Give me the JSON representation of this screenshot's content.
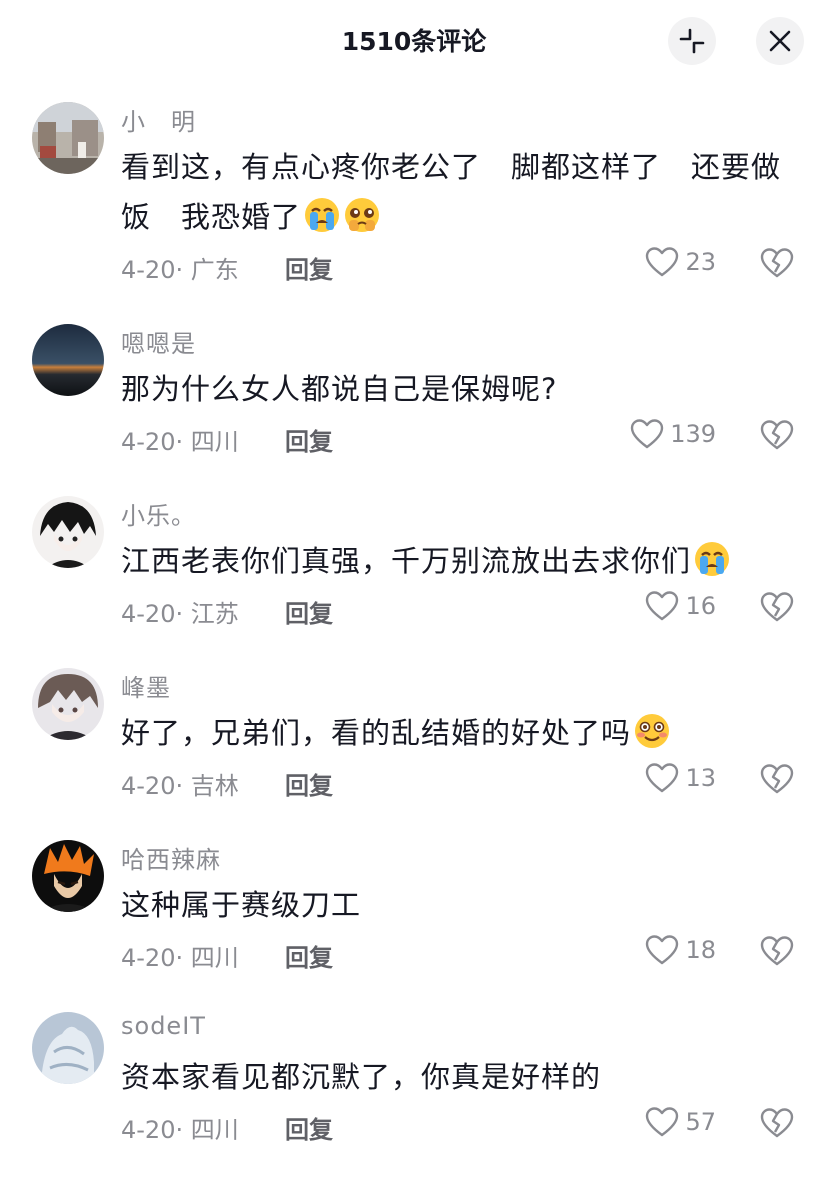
{
  "header": {
    "title": "1510条评论"
  },
  "comments": [
    {
      "username": "小　明",
      "text": "看到这，有点心疼你老公了　脚都这样了　还要做饭　我恐婚了",
      "emojis": [
        "loudly-crying-emoji",
        "pleading-face-emoji"
      ],
      "date_location": "4-20· 广东",
      "reply_label": "回复",
      "likes": "23"
    },
    {
      "username": "嗯嗯是",
      "text": "那为什么女人都说自己是保姆呢?",
      "emojis": [],
      "date_location": "4-20· 四川",
      "reply_label": "回复",
      "likes": "139"
    },
    {
      "username": "小乐。",
      "text": "江西老表你们真强，千万别流放出去求你们",
      "emojis": [
        "loudly-crying-emoji"
      ],
      "date_location": "4-20· 江苏",
      "reply_label": "回复",
      "likes": "16"
    },
    {
      "username": "峰墨",
      "text": "好了，兄弟们，看的乱结婚的好处了吗",
      "emojis": [
        "flushed-smile-emoji"
      ],
      "date_location": "4-20· 吉林",
      "reply_label": "回复",
      "likes": "13"
    },
    {
      "username": "哈西辣麻",
      "text": "这种属于赛级刀工",
      "emojis": [],
      "date_location": "4-20· 四川",
      "reply_label": "回复",
      "likes": "18"
    },
    {
      "username": "sodeIT",
      "text": "资本家看见都沉默了，你真是好样的",
      "emojis": [],
      "date_location": "4-20· 四川",
      "reply_label": "回复",
      "likes": "57"
    }
  ],
  "icons": {
    "collapse": "collapse-icon",
    "close": "close-icon",
    "like": "heart-icon",
    "dislike": "broken-heart-icon"
  },
  "colors": {
    "secondary_text": "#8a8b91",
    "primary_text": "#161823",
    "button_bg": "#f2f2f3"
  }
}
